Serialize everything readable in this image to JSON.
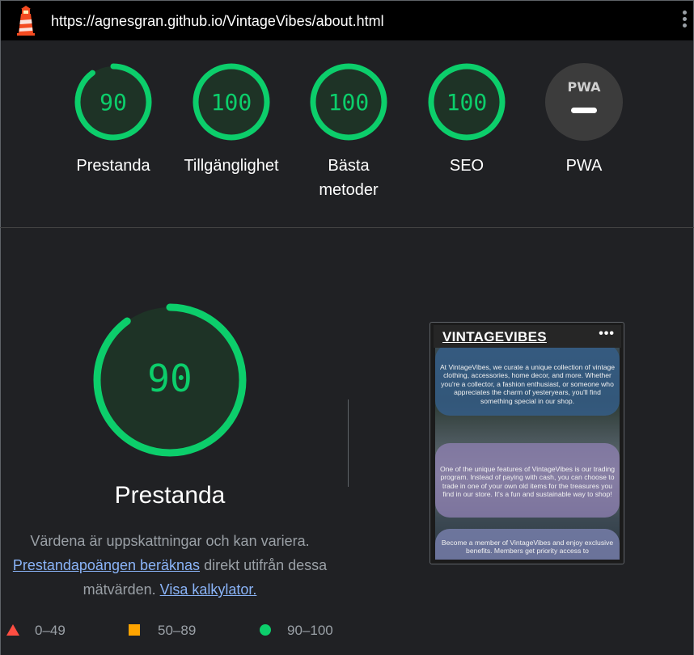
{
  "browser": {
    "url": "https://agnesgran.github.io/VintageVibes/about.html"
  },
  "colors": {
    "pass": "#0cce6b",
    "pass_fill": "#1e3326",
    "average": "#ffa400",
    "fail": "#ff4e42",
    "na": "#3c3c3c"
  },
  "gauges": [
    {
      "score": "90",
      "value": 90,
      "label": "Prestanda"
    },
    {
      "score": "100",
      "value": 100,
      "label": "Tillgänglighet"
    },
    {
      "score": "100",
      "value": 100,
      "label": "Bästa metoder"
    },
    {
      "score": "100",
      "value": 100,
      "label": "SEO"
    },
    {
      "badge": "PWA",
      "label": "PWA"
    }
  ],
  "performance": {
    "score": "90",
    "value": 90,
    "title": "Prestanda",
    "desc_text1": "Värdena är uppskattningar och kan variera.",
    "desc_link1": "Prestandapoängen beräknas",
    "desc_text2": "direkt utifrån dessa mätvärden.",
    "desc_link2": "Visa kalkylator."
  },
  "legend": [
    {
      "icon": "triangle-icon",
      "range": "0–49"
    },
    {
      "icon": "square-icon",
      "range": "50–89"
    },
    {
      "icon": "circle-icon",
      "range": "90–100"
    }
  ],
  "screenshot": {
    "brand": "VINTAGEVIBES",
    "menu": "•••",
    "card1": "At VintageVibes, we curate a unique collection of vintage clothing, accessories, home decor, and more. Whether you're a collector, a fashion enthusiast, or someone who appreciates the charm of yesteryears, you'll find something special in our shop.",
    "card2": "One of the unique features of VintageVibes is our trading program. Instead of paying with cash, you can choose to trade in one of your own old items for the treasures you find in our store. It's a fun and sustainable way to shop!",
    "card3": "Become a member of VintageVibes and enjoy exclusive benefits. Members get priority access to"
  }
}
